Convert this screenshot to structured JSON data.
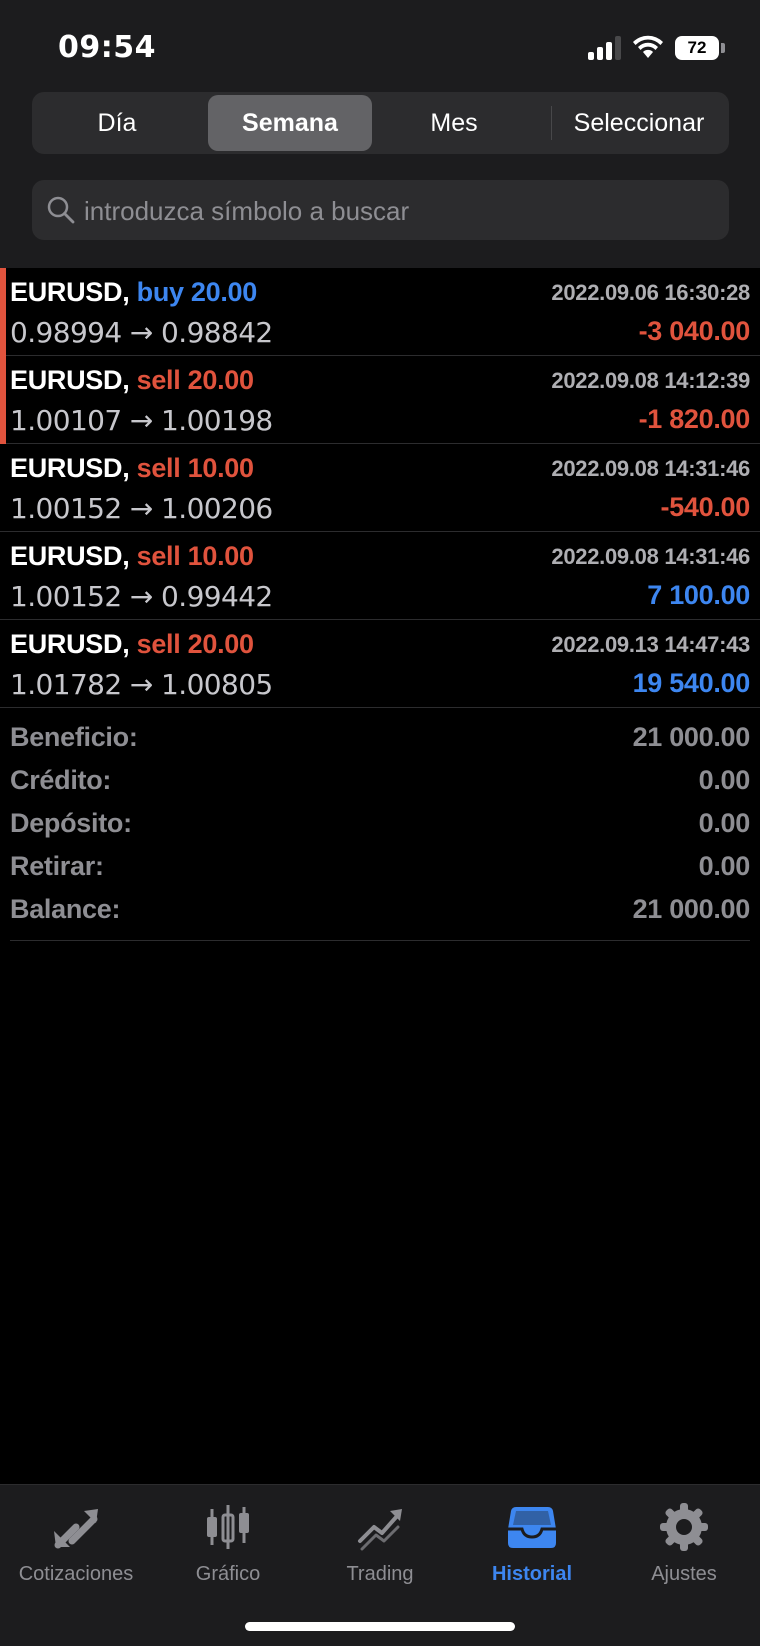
{
  "status_bar": {
    "time": "09:54",
    "battery": "72"
  },
  "segments": [
    {
      "label": "Día",
      "active": false
    },
    {
      "label": "Semana",
      "active": true
    },
    {
      "label": "Mes",
      "active": false
    },
    {
      "label": "Seleccionar",
      "active": false
    }
  ],
  "search": {
    "placeholder": "introduzca símbolo a buscar",
    "value": ""
  },
  "trades": [
    {
      "symbol": "EURUSD,",
      "type": "buy 20.00",
      "side": "buy",
      "datetime": "2022.09.06 16:30:28",
      "prices": "0.98994 → 0.98842",
      "profit": "-3 040.00",
      "profit_sign": "neg"
    },
    {
      "symbol": "EURUSD,",
      "type": "sell 20.00",
      "side": "sell",
      "datetime": "2022.09.08 14:12:39",
      "prices": "1.00107 → 1.00198",
      "profit": "-1 820.00",
      "profit_sign": "neg"
    },
    {
      "symbol": "EURUSD,",
      "type": "sell 10.00",
      "side": "sell",
      "datetime": "2022.09.08 14:31:46",
      "prices": "1.00152 → 1.00206",
      "profit": "-540.00",
      "profit_sign": "neg"
    },
    {
      "symbol": "EURUSD,",
      "type": "sell 10.00",
      "side": "sell",
      "datetime": "2022.09.08 14:31:46",
      "prices": "1.00152 → 0.99442",
      "profit": "7 100.00",
      "profit_sign": "pos"
    },
    {
      "symbol": "EURUSD,",
      "type": "sell 20.00",
      "side": "sell",
      "datetime": "2022.09.13 14:47:43",
      "prices": "1.01782 → 1.00805",
      "profit": "19 540.00",
      "profit_sign": "pos"
    }
  ],
  "summary": [
    {
      "label": "Beneficio:",
      "value": "21 000.00"
    },
    {
      "label": "Crédito:",
      "value": "0.00"
    },
    {
      "label": "Depósito:",
      "value": "0.00"
    },
    {
      "label": "Retirar:",
      "value": "0.00"
    },
    {
      "label": "Balance:",
      "value": "21 000.00"
    }
  ],
  "tabs": [
    {
      "label": "Cotizaciones",
      "icon": "quotes-arrows-icon",
      "active": false
    },
    {
      "label": "Gráfico",
      "icon": "candlestick-chart-icon",
      "active": false
    },
    {
      "label": "Trading",
      "icon": "trading-trend-icon",
      "active": false
    },
    {
      "label": "Historial",
      "icon": "inbox-tray-icon",
      "active": true
    },
    {
      "label": "Ajustes",
      "icon": "gear-icon",
      "active": false
    }
  ],
  "colors": {
    "buy": "#3d86f0",
    "sell": "#e0533d",
    "loss_marker": "#e0533d",
    "active_tab": "#3d86f0"
  }
}
